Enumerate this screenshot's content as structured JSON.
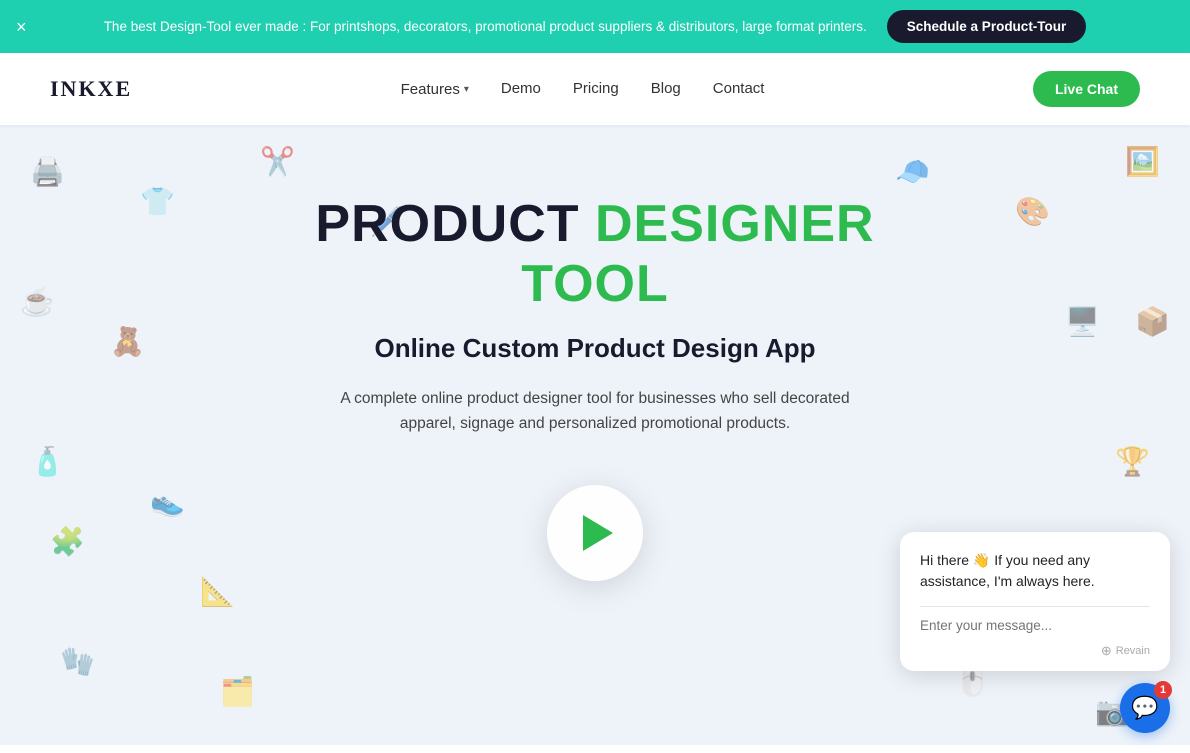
{
  "banner": {
    "message": "The best Design-Tool ever made : For printshops, decorators, promotional product suppliers & distributors, large format printers.",
    "cta_label": "Schedule a Product-Tour",
    "close_symbol": "×"
  },
  "navbar": {
    "logo": "INKXE",
    "links": [
      {
        "label": "Features",
        "has_dropdown": true
      },
      {
        "label": "Demo",
        "has_dropdown": false
      },
      {
        "label": "Pricing",
        "has_dropdown": false
      },
      {
        "label": "Blog",
        "has_dropdown": false
      },
      {
        "label": "Contact",
        "has_dropdown": false
      }
    ],
    "live_chat_label": "Live Chat"
  },
  "hero": {
    "title_black1": "PRODUCT ",
    "title_green": "DESIGNER TOOL",
    "subtitle": "Online Custom Product Design App",
    "description": "A complete online product designer tool for businesses who sell decorated apparel, signage and personalized promotional products."
  },
  "chat_widget": {
    "greeting": "Hi there 👋 If you need any assistance, I'm always here.",
    "input_placeholder": "Enter your message...",
    "branding": "Revain",
    "badge_count": "1"
  },
  "colors": {
    "accent_green": "#2dba4e",
    "banner_bg": "#1ecfb0",
    "chat_blue": "#1a6fe8",
    "hero_bg": "#eef3f9"
  }
}
